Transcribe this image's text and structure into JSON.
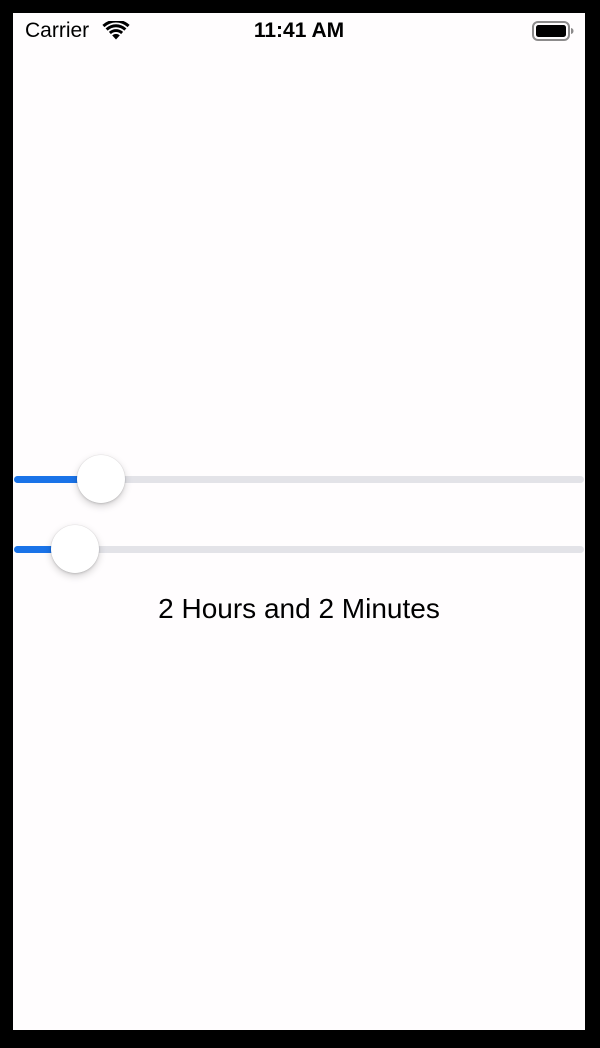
{
  "status_bar": {
    "carrier": "Carrier",
    "time": "11:41 AM",
    "wifi_icon": "wifi-icon",
    "battery_icon": "battery-icon"
  },
  "sliders": [
    {
      "name": "hours",
      "value_fraction": 0.12,
      "accent_color": "#1a73e8"
    },
    {
      "name": "minutes",
      "value_fraction": 0.07,
      "accent_color": "#1a73e8"
    }
  ],
  "duration_label": "2 Hours and 2 Minutes",
  "colors": {
    "background": "#fffdfe",
    "track": "#e3e3e8",
    "accent": "#1a73e8"
  }
}
